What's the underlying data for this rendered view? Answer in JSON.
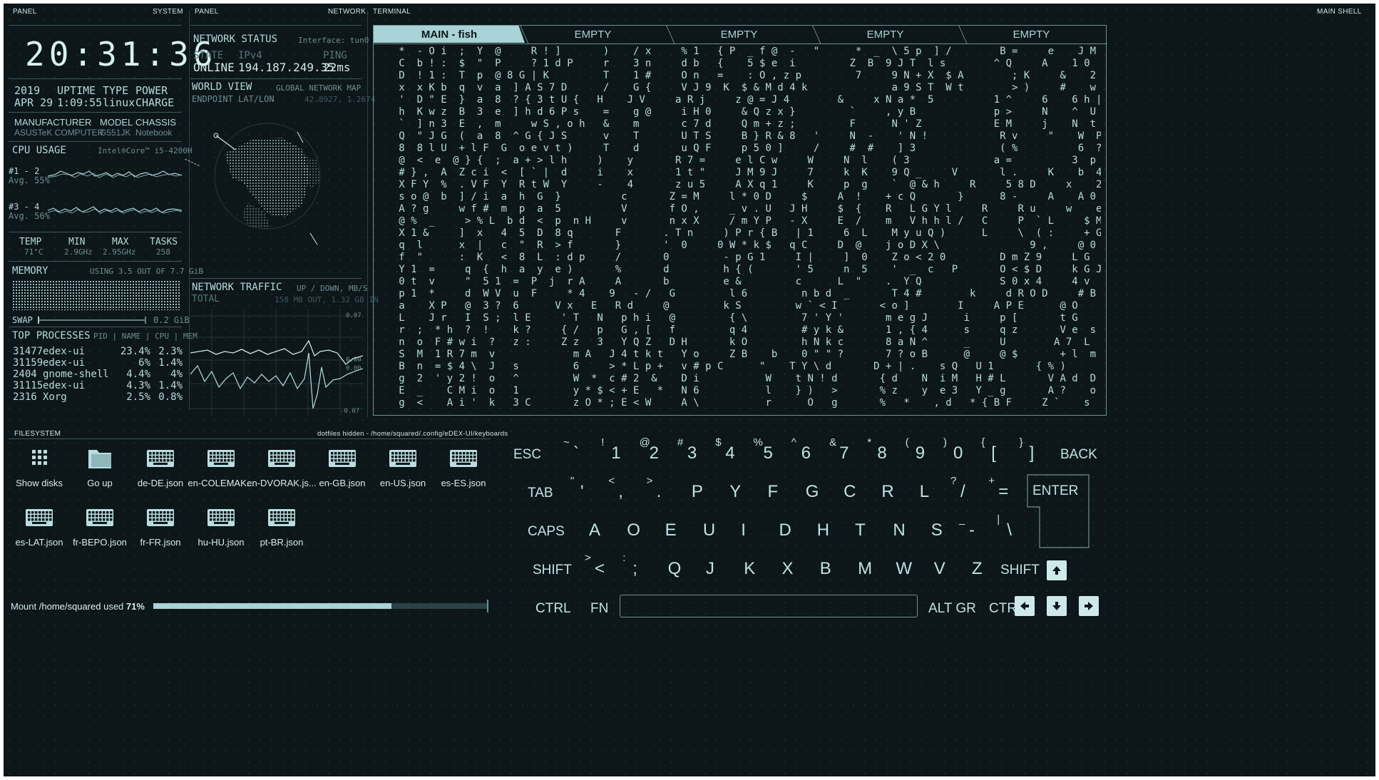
{
  "headers": {
    "panel_left": "PANEL",
    "system": "SYSTEM",
    "panel_mid": "PANEL",
    "network": "NETWORK",
    "terminal": "TERMINAL",
    "main_shell": "MAIN SHELL",
    "filesystem": "FILESYSTEM",
    "fs_path": "dotfiles hidden - /home/squared/.config/eDEX-UI/keyboards"
  },
  "system": {
    "clock": "20:31:36",
    "year": "2019",
    "date": "APR 29",
    "uptime_label": "UPTIME",
    "uptime": "1:09:55",
    "type_label": "TYPE",
    "type": "linux",
    "power_label": "POWER",
    "power": "CHARGE",
    "manufacturer_label": "MANUFACTURER",
    "manufacturer": "ASUSTeK COMPUTER",
    "model_label": "MODEL",
    "model": "G551JK",
    "chassis_label": "CHASSIS",
    "chassis": "Notebook",
    "cpu_label": "CPU USAGE",
    "cpu_name": "Intel®Core™ i5-4200H",
    "cpu_group1": "#1 - 2",
    "cpu_group1_avg": "Avg. 55%",
    "cpu_group2": "#3 - 4",
    "cpu_group2_avg": "Avg. 56%",
    "temp_label": "TEMP",
    "temp": "71°C",
    "min_label": "MIN",
    "min": "2.9GHz",
    "max_label": "MAX",
    "max": "2.95GHz",
    "tasks_label": "TASKS",
    "tasks": "258",
    "memory_label": "MEMORY",
    "memory_usage": "USING 3.5 OUT OF 7.7 GiB",
    "swap_label": "SWAP",
    "swap": "0.2 GiB",
    "top_label": "TOP PROCESSES",
    "top_cols": "PID | NAME | CPU | MEM",
    "processes": [
      {
        "pid": "31477",
        "name": "edex-ui",
        "cpu": "23.4%",
        "mem": "2.3%"
      },
      {
        "pid": "31159",
        "name": "edex-ui",
        "cpu": "6%",
        "mem": "1.4%"
      },
      {
        "pid": "2404",
        "name": "gnome-shell",
        "cpu": "4.4%",
        "mem": "4%"
      },
      {
        "pid": "31115",
        "name": "edex-ui",
        "cpu": "4.3%",
        "mem": "1.4%"
      },
      {
        "pid": "2316",
        "name": "Xorg",
        "cpu": "2.5%",
        "mem": "0.8%"
      }
    ]
  },
  "network": {
    "status_label": "NETWORK STATUS",
    "interface": "Interface: tun0",
    "state_label": "STATE",
    "state": "ONLINE",
    "ipv4_label": "IPv4",
    "ip": "194.187.249.35",
    "ping_label": "PING",
    "ping": "22ms",
    "world_label": "WORLD VIEW",
    "world_sub": "GLOBAL NETWORK MAP",
    "endpoint_label": "ENDPOINT LAT/LON",
    "endpoint": "42.8927, 1.2674",
    "traffic_label": "NETWORK TRAFFIC",
    "traffic_sub": "UP / DOWN, MB/S",
    "total_label": "TOTAL",
    "total": "158 MB OUT, 1.32 GB IN",
    "y_top": "0.07",
    "y_bottom": "-0.07",
    "y_mid1": "0.00",
    "y_mid2": "0.00"
  },
  "terminal": {
    "tabs": [
      "MAIN - fish",
      "EMPTY",
      "EMPTY",
      "EMPTY",
      "EMPTY"
    ],
    "lines": [
      "   *  - O i  ;  Y  @     R ! ]       )    / x     % 1   { P  _ f @  -   \"      *  _  \\ 5 p  ] /        B =     e    J M",
      "   C  b ! :  $  \"  P     ? 1 d P     r    3 n     d b   {    5 $ e  i         Z  B  9 J T  l s        ^ Q     A    1 0",
      "   D  ! 1 :  T  p  @ 8 G | K         T    1 #     O n   =    : O , z p         7     9 N + X  $ A        ; K     &    2 s F l",
      "   x  x K b  q  v  a  ] A S 7 D      /    G {     V J 9  K  $ & M d 4 k              a 9 S T  W t        > )     #    w t 0 p",
      "   '  D \" E  }  a  8  ? { 3 t U {   H    J V     a R j     z @ = J 4        &     x N a *  5          1 ^     6    6 h | Y",
      "   h  K w z  B  3  e  ] h d 6 P s    =    g @     i H 0     & Q z x }         `     , y B             p >     N    ^  U }",
      "   `  ] n 3  E  ,  m     w S , o h   &    m       c 7 d     Q m + z ;         F      N ' Z            E M     j    N  t =",
      "   Q  \" J G  (  a  8  ^ G { J S      v    T       U T S     B } R & 8   '     N  -    ' N !            R v     \"    W  P k",
      "   8  8 l U  + l F  G  o e v t )     T    d       u Q F     p 5 0 ]     /     #  #    ] 3              ( %          6  ? a",
      "   @  <  e  @ } {  ;  a + > l h     )    y       R 7 =     e l C w     W     N  l    ( 3              a =          3  p H",
      "   # } ,  A  Z c i  <  [ ` |  d     i    x       1 t \"     J M 9 J     7     k  K    9 Q _     V       l .     K    b  4 H",
      "   X F Y  %  . V F  Y  R t W  Y     -    4       z u 5     A X q 1     K     p  g    `  @ & h     R     5 8 D     x    2  L s",
      "   s o @  b  ] / i  a  h  G  }          c       Z = M     l * 0 D     $     A  !    + c Q       }      8 -     A    A 0 \\ z ]",
      "   A ? g     w f #  m  p  a  5          V       f O ,     _ v . U   J H     $  {    R   L G Y l     R     R u     w    e  y  u",
      "   @ %  _     > % L  b d  <  p  n H     v       n x X     / m Y P   - X     E  /    m   V h h l /   C     P  ` L     $ M   ?  P",
      "   X 1 &     ]  x   4  5  D  8 q       F       . T n     ) P r { B   | 1     6  L    M y u Q )      L     \\  ( :     + G   +  A",
      "   q  l      x  |   c  \"  R  > f       }       '  0     0 W * k $   q C     D  @    j o D X \\               9 ,     @ 0   h  b",
      "   f  \"      :  K   <  8  L  : d p     /       0         - p G 1     I |     ]  0    Z o < 2 0         D m Z 9     L G   a  <",
      "   Y 1  =     q  {  h  a  y  e )       %       d         h { (       ' 5     n  5    '  _  c   P       O < $ D     k G J     n",
      "   0 t  v     \"  5 1  =  P  j  r A     A       b         e &         c      L  \"    .  Y Q             S 0 x 4     4 v      L",
      "   p 1  *     d  W V  u  F     * 4    9   - /   G         l 6         n b d  _       T 4 #        k     d R O D     # B      1",
      "   a    X P   @  3 ?  6      V x   E   R d     @         k S         w ` < I       < o ]        I     A P E      @ O      1",
      "   L    J r   I  S ;  l E     ' T   N   p h i   @         { \\         7 ' Y '       m e g J      i     p [       t G      [",
      "   r  ;  * h  ?  !    k ?     { /   p   G , [   f         q 4         # y k &       1 , { 4      s     q z       V e  s   s",
      "   n  o  F # w i  ?   z :     Z z   3   Y Q Z   D H       k O         h N k c       8 a N ^      _     U        A 7  L   d",
      "   S  M  1 R 7 m  v             m A   J 4 t k t   Y o     Z B    b    0 \" \" ?       7 ? o B      @     @ $       + l  m   l",
      "   B  n  = $ 4 \\  J   s         6     > * L p +   v # p C      \"    T Y \\ d       D + | .    s Q   U 1       { % )",
      "   g  2  ' y 2 !  o   ^         W  *  c # 2  &    D i           W    t N ! d       { d    N  i M   H # L       V A d  D",
      "   E  _    C M i  o   1         y * $ < + E   *   N 6           l    } )   >       % z    y  e 3   Y _ g       A ?    o",
      "   g  <    A i '  k   3 C       z O * ; E < W     A \\           r      O   g       %   *    , d   * { B F     Z `    s"
    ]
  },
  "filesystem": {
    "items": [
      {
        "label": "Show disks",
        "icon": "grid-icon"
      },
      {
        "label": "Go up",
        "icon": "folder-icon"
      },
      {
        "label": "de-DE.json",
        "icon": "keyboard-icon"
      },
      {
        "label": "en-COLEMAK...",
        "icon": "keyboard-icon"
      },
      {
        "label": "en-DVORAK.js...",
        "icon": "keyboard-icon"
      },
      {
        "label": "en-GB.json",
        "icon": "keyboard-icon"
      },
      {
        "label": "en-US.json",
        "icon": "keyboard-icon"
      },
      {
        "label": "es-ES.json",
        "icon": "keyboard-icon"
      },
      {
        "label": "es-LAT.json",
        "icon": "keyboard-icon"
      },
      {
        "label": "fr-BEPO.json",
        "icon": "keyboard-icon"
      },
      {
        "label": "fr-FR.json",
        "icon": "keyboard-icon"
      },
      {
        "label": "hu-HU.json",
        "icon": "keyboard-icon"
      },
      {
        "label": "pt-BR.json",
        "icon": "keyboard-icon"
      }
    ],
    "mount_prefix": "Mount ",
    "mount_path": "/home/squared",
    "mount_suffix": " used ",
    "mount_used": "71%",
    "mount_fraction": 0.71
  },
  "keyboard": {
    "row1": [
      [
        "~",
        "`"
      ],
      [
        "!",
        "1"
      ],
      [
        "@",
        "2"
      ],
      [
        "#",
        "3"
      ],
      [
        "$",
        "4"
      ],
      [
        "%",
        "5"
      ],
      [
        "^",
        "6"
      ],
      [
        "&",
        "7"
      ],
      [
        "*",
        "8"
      ],
      [
        "(",
        "9"
      ],
      [
        ")",
        "0"
      ],
      [
        "{",
        "["
      ],
      [
        "}",
        "]"
      ]
    ],
    "row2": [
      [
        "\"",
        "'"
      ],
      [
        "<",
        ","
      ],
      [
        ">",
        "."
      ],
      [
        "",
        "P"
      ],
      [
        "",
        "Y"
      ],
      [
        "",
        "F"
      ],
      [
        "",
        "G"
      ],
      [
        "",
        "C"
      ],
      [
        "",
        "R"
      ],
      [
        "",
        "L"
      ],
      [
        "?",
        "/"
      ],
      [
        "+",
        "="
      ]
    ],
    "row3": [
      "A",
      "O",
      "E",
      "U",
      "I",
      "D",
      "H",
      "T",
      "N",
      "S"
    ],
    "row3_extra": [
      [
        "_",
        "-"
      ],
      [
        "|",
        "\\"
      ]
    ],
    "row4": [
      [
        ">",
        "<"
      ],
      [
        ":",
        ";"
      ],
      [
        "",
        "Q"
      ],
      [
        "",
        "J"
      ],
      [
        "",
        "K"
      ],
      [
        "",
        "X"
      ],
      [
        "",
        "B"
      ],
      [
        "",
        "M"
      ],
      [
        "",
        "W"
      ],
      [
        "",
        "V"
      ],
      [
        "",
        "Z"
      ]
    ],
    "esc": "ESC",
    "back": "BACK",
    "tab": "TAB",
    "enter": "ENTER",
    "caps": "CAPS",
    "shift": "SHIFT",
    "shift_r": "SHIFT",
    "ctrl": "CTRL",
    "fn": "FN",
    "altgr": "ALT GR",
    "ctrl_r": "CTRL"
  },
  "colors": {
    "accent": "#a9d3d6",
    "background": "#0d1619",
    "border": "#3c5a60"
  }
}
